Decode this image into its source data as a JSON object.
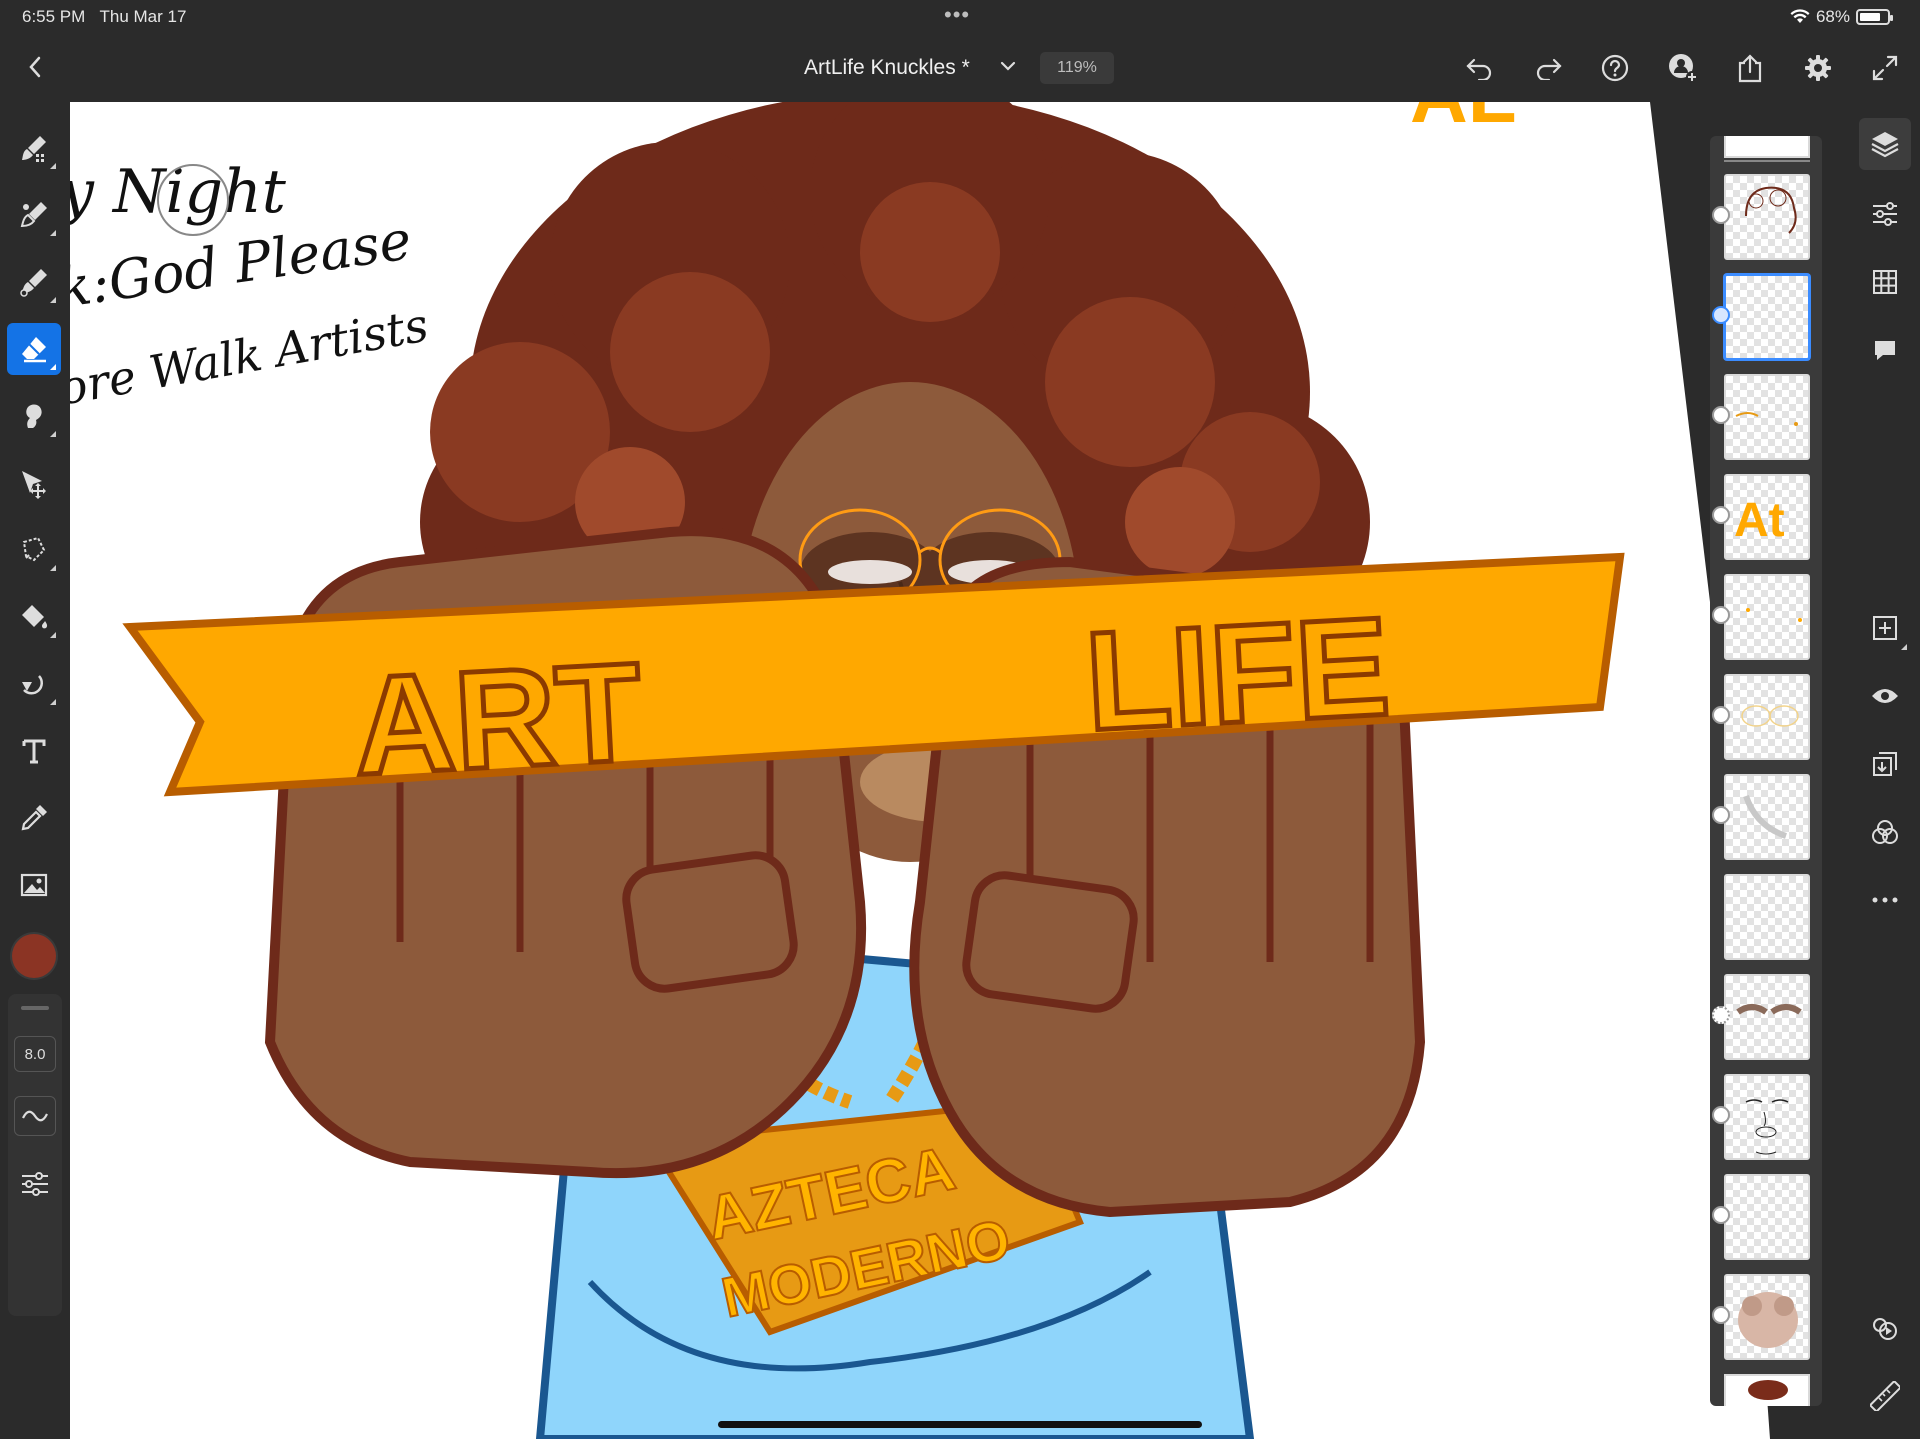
{
  "status_bar": {
    "time": "6:55 PM",
    "date": "Thu Mar 17",
    "battery": "68%",
    "dots": "•••"
  },
  "top_bar": {
    "document_title": "ArtLife Knuckles *",
    "zoom": "119%",
    "icons": [
      "back-icon",
      "chevron-down-icon",
      "undo-icon",
      "redo-icon",
      "help-icon",
      "invite-icon",
      "share-icon",
      "settings-icon",
      "fullscreen-icon"
    ]
  },
  "left_tools": {
    "icons": [
      "pixel-brush-icon",
      "live-brush-icon",
      "vector-brush-icon",
      "eraser-icon",
      "smudge-icon",
      "transform-icon",
      "selection-icon",
      "fill-icon",
      "liquify-icon",
      "type-icon",
      "eyedropper-icon",
      "image-icon"
    ],
    "active": "eraser-icon",
    "current_color": "#8b3424",
    "brush_size": "8.0"
  },
  "canvas": {
    "handwriting": [
      "y Night",
      "k:God Please",
      "ore Walk Artists"
    ],
    "banner_word_left": "ART",
    "banner_word_right": "LIFE",
    "pendant_line1": "AZTECA",
    "pendant_line2": "MODERNO",
    "corner_mark": "AL",
    "colors": {
      "banner": "#ffa800",
      "banner_outline": "#b85d00",
      "skin": "#8d5a3b",
      "hair": "#6e2a1a",
      "shirt": "#8fd5fb",
      "shirt_outline": "#1a5790"
    }
  },
  "layers_panel": {
    "thumbnails": [
      {
        "name": "layer-hair-sketch",
        "selected": false
      },
      {
        "name": "layer-empty-selected",
        "selected": true
      },
      {
        "name": "layer-glasses",
        "selected": false
      },
      {
        "name": "layer-al-logo",
        "selected": false,
        "text": "At"
      },
      {
        "name": "layer-highlights",
        "selected": false
      },
      {
        "name": "layer-glasses-outline",
        "selected": false
      },
      {
        "name": "layer-face-shading",
        "selected": false
      },
      {
        "name": "layer-blank",
        "selected": false
      },
      {
        "name": "layer-eyebrows",
        "selected": false
      },
      {
        "name": "layer-face-lineart",
        "selected": false
      },
      {
        "name": "layer-blank-2",
        "selected": false
      },
      {
        "name": "layer-hair-color",
        "selected": false
      }
    ]
  },
  "right_tools": {
    "icons": [
      "layers-icon",
      "adjustments-icon",
      "grid-icon",
      "comments-icon",
      "add-layer-icon",
      "visibility-icon",
      "merge-down-icon",
      "blend-icon",
      "more-icon",
      "history-icon",
      "ruler-icon"
    ]
  }
}
